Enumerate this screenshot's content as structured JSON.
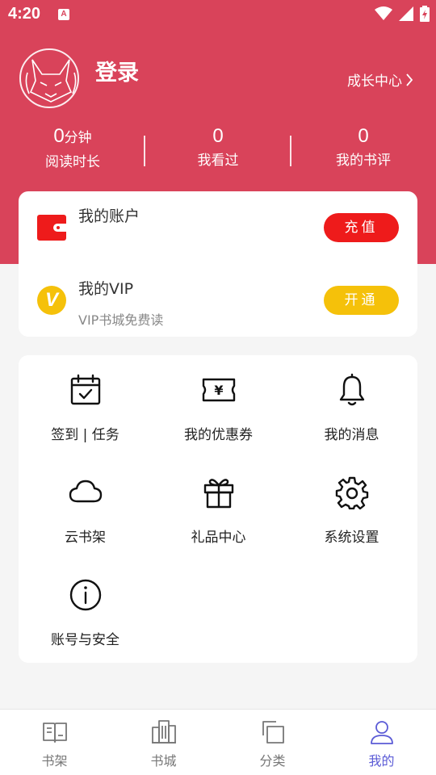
{
  "status_bar": {
    "time": "4:20",
    "notification_icon": "A"
  },
  "profile": {
    "login_label": "登录",
    "growth_center": "成长中心",
    "stats": [
      {
        "value": "0",
        "unit": "分钟",
        "label": "阅读时长"
      },
      {
        "value": "0",
        "unit": "",
        "label": "我看过"
      },
      {
        "value": "0",
        "unit": "",
        "label": "我的书评"
      }
    ]
  },
  "account": {
    "title": "我的账户",
    "recharge_button": "充值",
    "vip_title": "我的VIP",
    "vip_subtitle": "VIP书城免费读",
    "open_button": "开通",
    "vip_badge": "V"
  },
  "menu": [
    {
      "icon": "calendar-check-icon",
      "label": "签到 | 任务"
    },
    {
      "icon": "coupon-icon",
      "label": "我的优惠券"
    },
    {
      "icon": "bell-icon",
      "label": "我的消息"
    },
    {
      "icon": "cloud-icon",
      "label": "云书架"
    },
    {
      "icon": "gift-icon",
      "label": "礼品中心"
    },
    {
      "icon": "gear-icon",
      "label": "系统设置"
    },
    {
      "icon": "info-icon",
      "label": "账号与安全"
    }
  ],
  "bottom_nav": [
    {
      "icon": "bookshelf-icon",
      "label": "书架"
    },
    {
      "icon": "bookstore-icon",
      "label": "书城"
    },
    {
      "icon": "category-icon",
      "label": "分类"
    },
    {
      "icon": "profile-icon",
      "label": "我的",
      "active": true
    }
  ],
  "colors": {
    "header": "#d9435a",
    "recharge": "#ee1b1b",
    "vip": "#f5c10a",
    "nav_active": "#5b5bd6"
  }
}
